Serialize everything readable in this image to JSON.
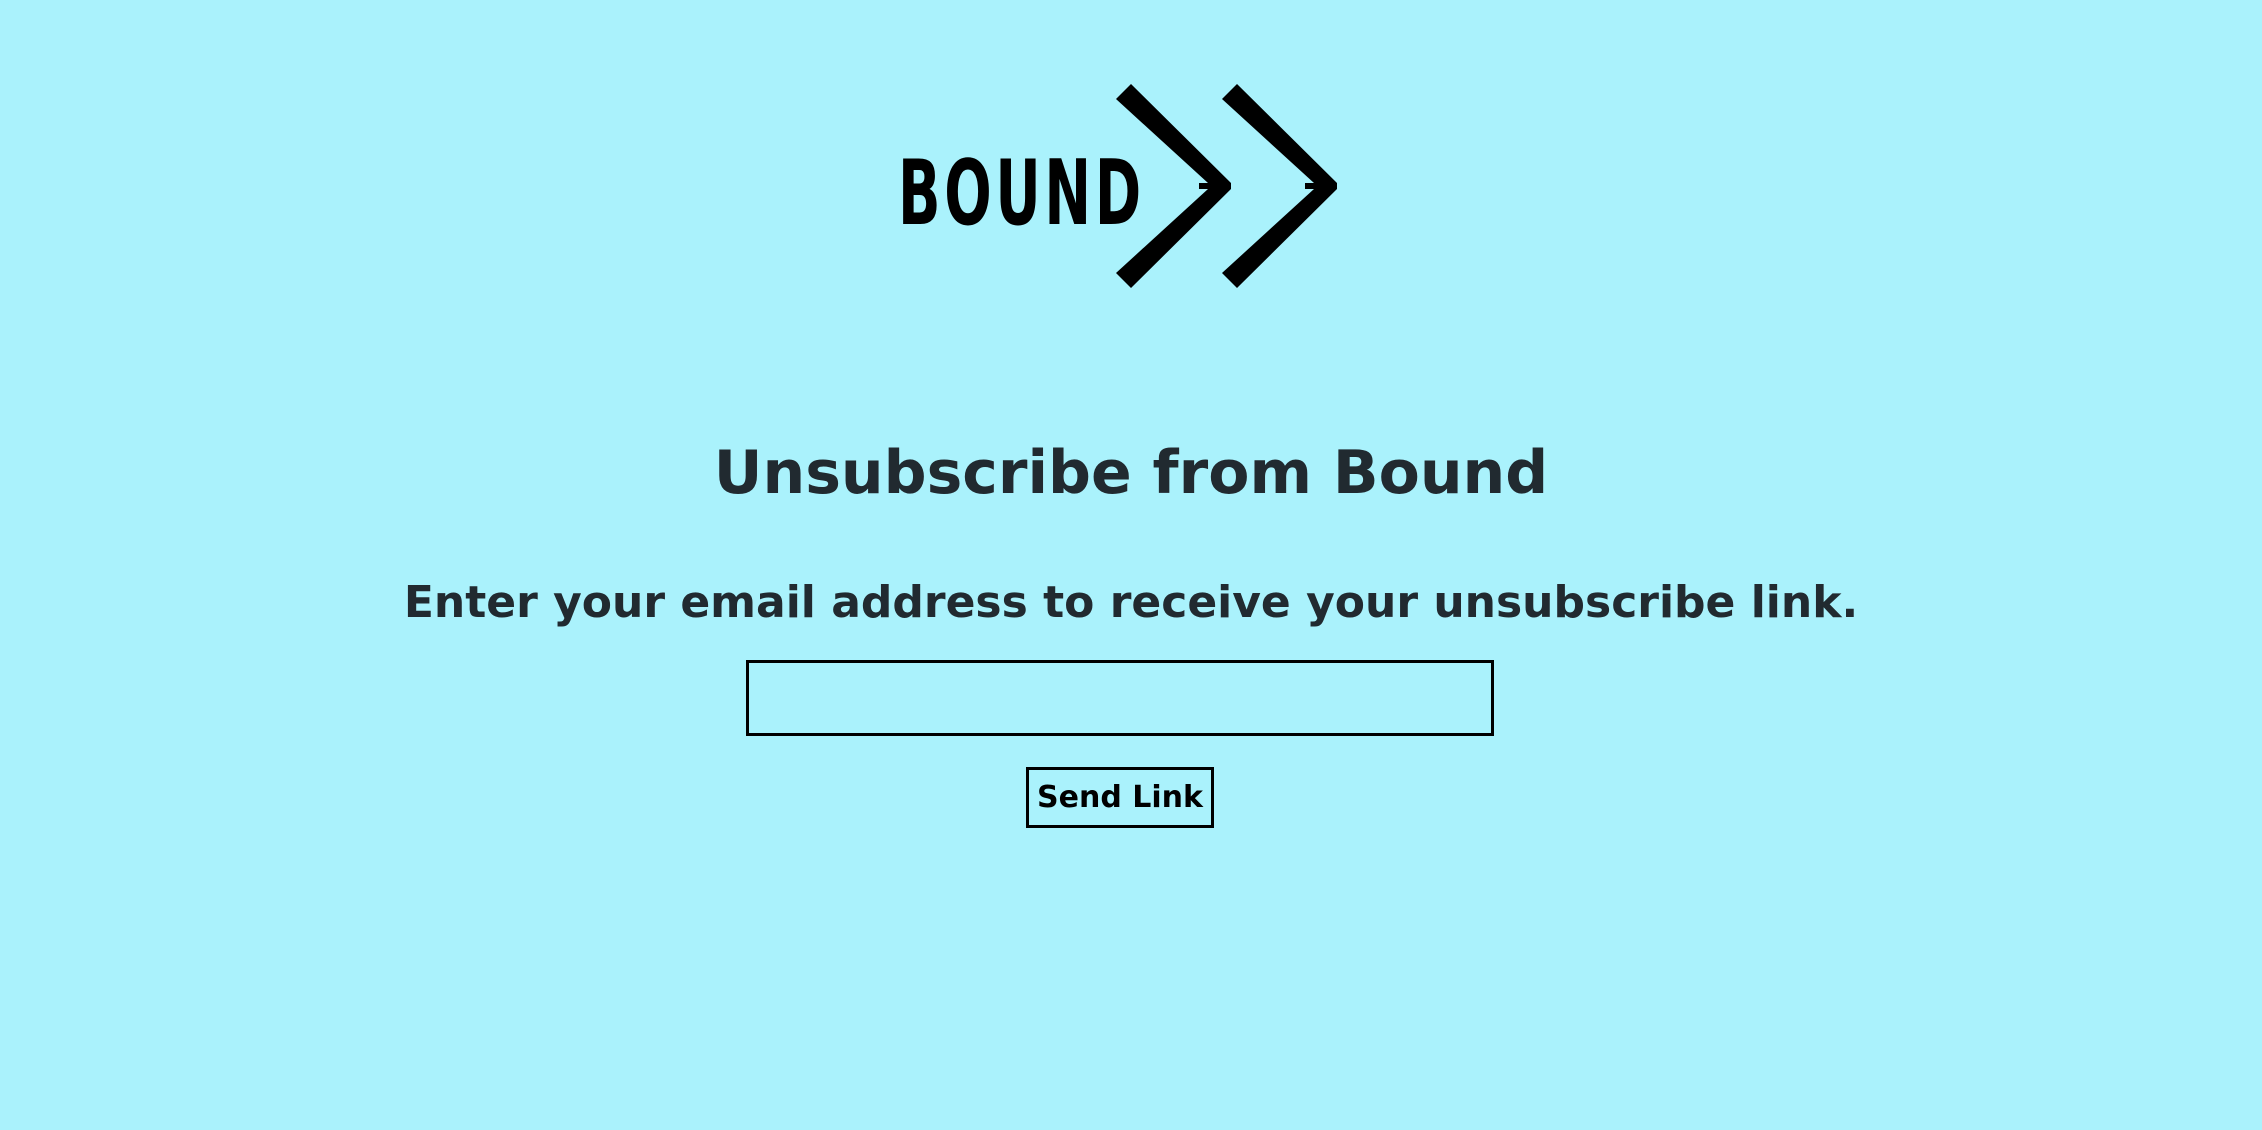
{
  "brand": {
    "name": "BOUND",
    "logo_icon": "double-chevron-right-icon",
    "color": "#000000"
  },
  "colors": {
    "background": "#aaf2fc",
    "text": "#212a30",
    "border": "#000000"
  },
  "page": {
    "title": "Unsubscribe from Bound",
    "instructions": "Enter your email address to receive your unsubscribe link."
  },
  "form": {
    "email_value": "",
    "email_placeholder": "",
    "submit_label": "Send Link"
  }
}
